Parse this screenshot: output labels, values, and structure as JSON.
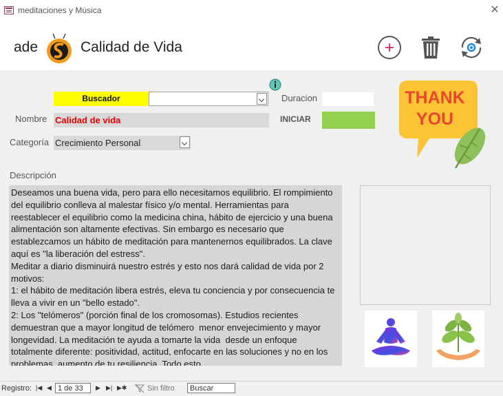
{
  "window": {
    "title": "meditaciones y Música",
    "icon": "form-icon",
    "close_icon": "close-icon"
  },
  "header": {
    "brand_text": "ade",
    "page_title": "Calidad de Vida",
    "buttons": {
      "add_icon": "plus-circle-icon",
      "delete_icon": "trash-icon",
      "refresh_icon": "refresh-icon"
    }
  },
  "form": {
    "buscador_label": "Buscador",
    "buscador_value": "",
    "nombre_label": "Nombre",
    "nombre_value": "Calidad de vida",
    "categoria_label": "Categoría",
    "categoria_value": "Crecimiento Personal",
    "duracion_label": "Duracion",
    "duracion_value": "",
    "iniciar_label": "INICIAR",
    "descripcion_label": "Descripción",
    "descripcion_value": "Deseamos una buena vida, pero para ello necesitamos equilibrio. El rompimiento del equilibrio conlleva al malestar físico y/o mental. Herramientas para reestablecer el equilibrio como la medicina china, hábito de ejercicio y una buena alimentación son altamente efectivas. Sin embargo es necesario que establezcamos un hábito de meditación para mantenernos equilibrados. La clave aquí es \"la liberación del estress\".\nMeditar a diario disminuirá nuestro estrés y esto nos dará calidad de vida por 2 motivos:\n1: el hábito de meditación libera estrés, eleva tu conciencia y por consecuencia te lleva a vivir en un \"bello estado\".\n2: Los \"telómeros\" (porción final de los cromosomas). Estudios recientes demuestran que a mayor longitud de telómero  menor envejecimiento y mayor longevidad. La meditación te ayuda a tomarte la vida  desde un enfoque totalmente diferente: positividad, actitud, enfocarte en las soluciones y no en los problemas, aumento de tu resiliencia. Todo esto"
  },
  "images": {
    "thank_you_line1": "THANK",
    "thank_you_line2": "YOU",
    "meditation": "meditation-figure-icon",
    "plant": "plant-hands-icon"
  },
  "colors": {
    "buscador_bg": "#ffff00",
    "nombre_text": "#e00000",
    "iniciar_bg": "#92d050",
    "add_button": "#e0245e",
    "refresh_button": "#1e88e5"
  },
  "navigator": {
    "registro_label": "Registro:",
    "record_position": "1 de 33",
    "filter_status": "Sin filtro",
    "search_placeholder": "Buscar"
  }
}
